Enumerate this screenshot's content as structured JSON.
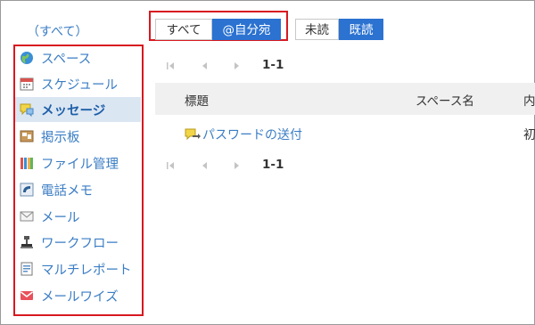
{
  "sidebar": {
    "all_label": "（すべて）",
    "items": [
      {
        "label": "スペース",
        "icon": "space-globe-icon"
      },
      {
        "label": "スケジュール",
        "icon": "calendar-icon"
      },
      {
        "label": "メッセージ",
        "icon": "message-icon",
        "active": true
      },
      {
        "label": "掲示板",
        "icon": "bulletin-board-icon"
      },
      {
        "label": "ファイル管理",
        "icon": "file-management-icon"
      },
      {
        "label": "電話メモ",
        "icon": "phone-memo-icon"
      },
      {
        "label": "メール",
        "icon": "mail-icon"
      },
      {
        "label": "ワークフロー",
        "icon": "workflow-icon"
      },
      {
        "label": "マルチレポート",
        "icon": "multi-report-icon"
      },
      {
        "label": "メールワイズ",
        "icon": "mailwise-icon"
      }
    ]
  },
  "filters": {
    "scope": {
      "all": "すべて",
      "mentions": "@自分宛",
      "selected": "mentions"
    },
    "read": {
      "unread": "未読",
      "read": "既読",
      "selected": "read"
    }
  },
  "pager": {
    "range": "1-1"
  },
  "table": {
    "headers": [
      "標題",
      "スペース名",
      "内"
    ],
    "rows": [
      {
        "title": "パスワードの送付",
        "space": "",
        "extra": "初"
      }
    ]
  },
  "colors": {
    "accent": "#2b72d1",
    "link": "#3b7dc4",
    "highlight_border": "#d71920",
    "active_row": "#dbe6f3",
    "header_bg": "#f0f0f0"
  }
}
